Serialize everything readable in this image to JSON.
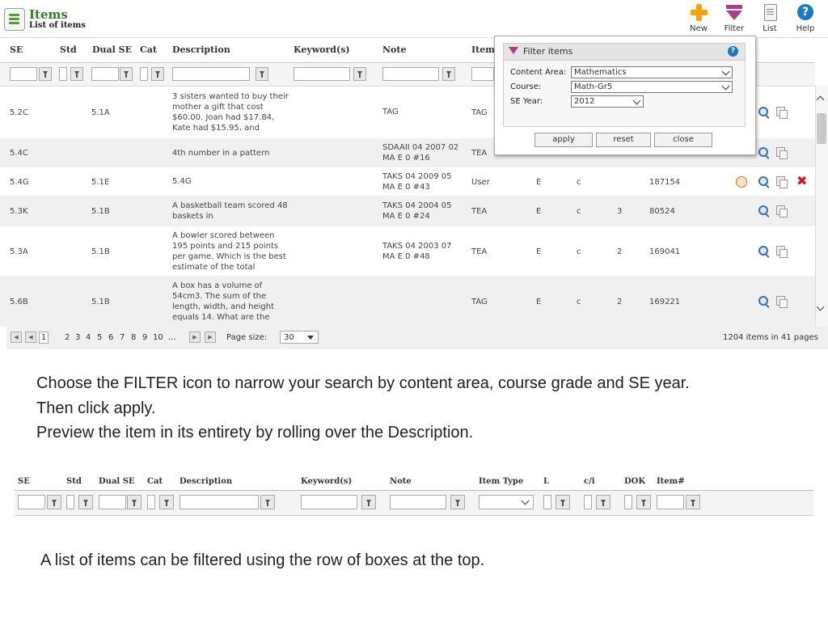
{
  "header": {
    "title": "Items",
    "subtitle": "List of items",
    "toolbar": [
      {
        "label": "New",
        "icon": "plus-icon"
      },
      {
        "label": "Filter",
        "icon": "filter-icon"
      },
      {
        "label": "List",
        "icon": "list-icon"
      },
      {
        "label": "Help",
        "icon": "help-icon"
      }
    ]
  },
  "grid": {
    "columns": [
      "SE",
      "Std",
      "Dual SE",
      "Cat",
      "Description",
      "Keyword(s)",
      "Note",
      "Item"
    ],
    "rows": [
      {
        "se": "5.2C",
        "std": "",
        "dual": "5.1A",
        "desc": "3 sisters wanted to buy their mother a gift that cost $60.00.  Joan had $17.84, Kate had $15.95, and",
        "note": "TAG",
        "type": "TAG",
        "l": "",
        "ci": "",
        "dok": "",
        "item": "",
        "actions": [
          "preview",
          "copy"
        ]
      },
      {
        "se": "5.4C",
        "std": "",
        "dual": "",
        "desc": "4th number in a pattern",
        "note": "SDAAII 04 2007 02 MA E 0 #16",
        "type": "TEA",
        "l": "",
        "ci": "",
        "dok": "",
        "item": "",
        "actions": [
          "preview",
          "copy"
        ]
      },
      {
        "se": "5.4G",
        "std": "",
        "dual": "5.1E",
        "desc": "5.4G",
        "note": "TAKS 04 2009 05 MA E 0 #43",
        "type": "User",
        "l": "E",
        "ci": "c",
        "dok": "",
        "item": "187154",
        "actions": [
          "edit",
          "preview",
          "copy",
          "delete"
        ]
      },
      {
        "se": "5.3K",
        "std": "",
        "dual": "5.1B",
        "desc": "A basketball team scored 48 baskets in",
        "note": "TAKS 04 2004 05 MA E 0 #24",
        "type": "TEA",
        "l": "E",
        "ci": "c",
        "dok": "3",
        "item": "80524",
        "actions": [
          "preview",
          "copy"
        ]
      },
      {
        "se": "5.3A",
        "std": "",
        "dual": "5.1B",
        "desc": "A bowler scored between 195 points and 215 points per game. Which is the best estimate of the total",
        "note": "TAKS 04 2003 07 MA E 0 #48",
        "type": "TEA",
        "l": "E",
        "ci": "c",
        "dok": "2",
        "item": "169041",
        "actions": [
          "preview",
          "copy"
        ]
      },
      {
        "se": "5.6B",
        "std": "",
        "dual": "5.1B",
        "desc": "A box has a volume of 54cm3. The sum of the length, width, and height equals 14. What are the",
        "note": "",
        "type": "TAG",
        "l": "E",
        "ci": "c",
        "dok": "2",
        "item": "169221",
        "actions": [
          "preview",
          "copy"
        ]
      }
    ]
  },
  "pager": {
    "pages": [
      "2",
      "3",
      "4",
      "5",
      "6",
      "7",
      "8",
      "9",
      "10",
      "..."
    ],
    "current": "1",
    "page_size_label": "Page size:",
    "page_size": "30",
    "summary": "1204 items in 41 pages"
  },
  "filter_popup": {
    "title": "Filter items",
    "content_area_label": "Content Area:",
    "content_area_value": "Mathematics",
    "course_label": "Course:",
    "course_value": "Math-Gr5",
    "se_year_label": "SE Year:",
    "se_year_value": "2012",
    "apply": "apply",
    "reset": "reset",
    "close": "close"
  },
  "captions": {
    "line1": "Choose the FILTER icon to narrow your search by content area, course grade and SE year.",
    "line2": "Then click apply.",
    "line3": "Preview the item in its entirety by rolling over the Description.",
    "bottom": "A list of items can be filtered using the row of boxes at the top."
  },
  "bottom_grid": {
    "columns": [
      "SE",
      "Std",
      "Dual SE",
      "Cat",
      "Description",
      "Keyword(s)",
      "Note",
      "Item Type",
      "L",
      "c/i",
      "DOK",
      "Item#"
    ]
  },
  "colors": {
    "accent_green": "#3a7a2a",
    "filter_purple": "#b03a8a",
    "plus_orange": "#f4a300",
    "help_blue": "#1a7ac8",
    "delete_red": "#cc1a1a"
  }
}
